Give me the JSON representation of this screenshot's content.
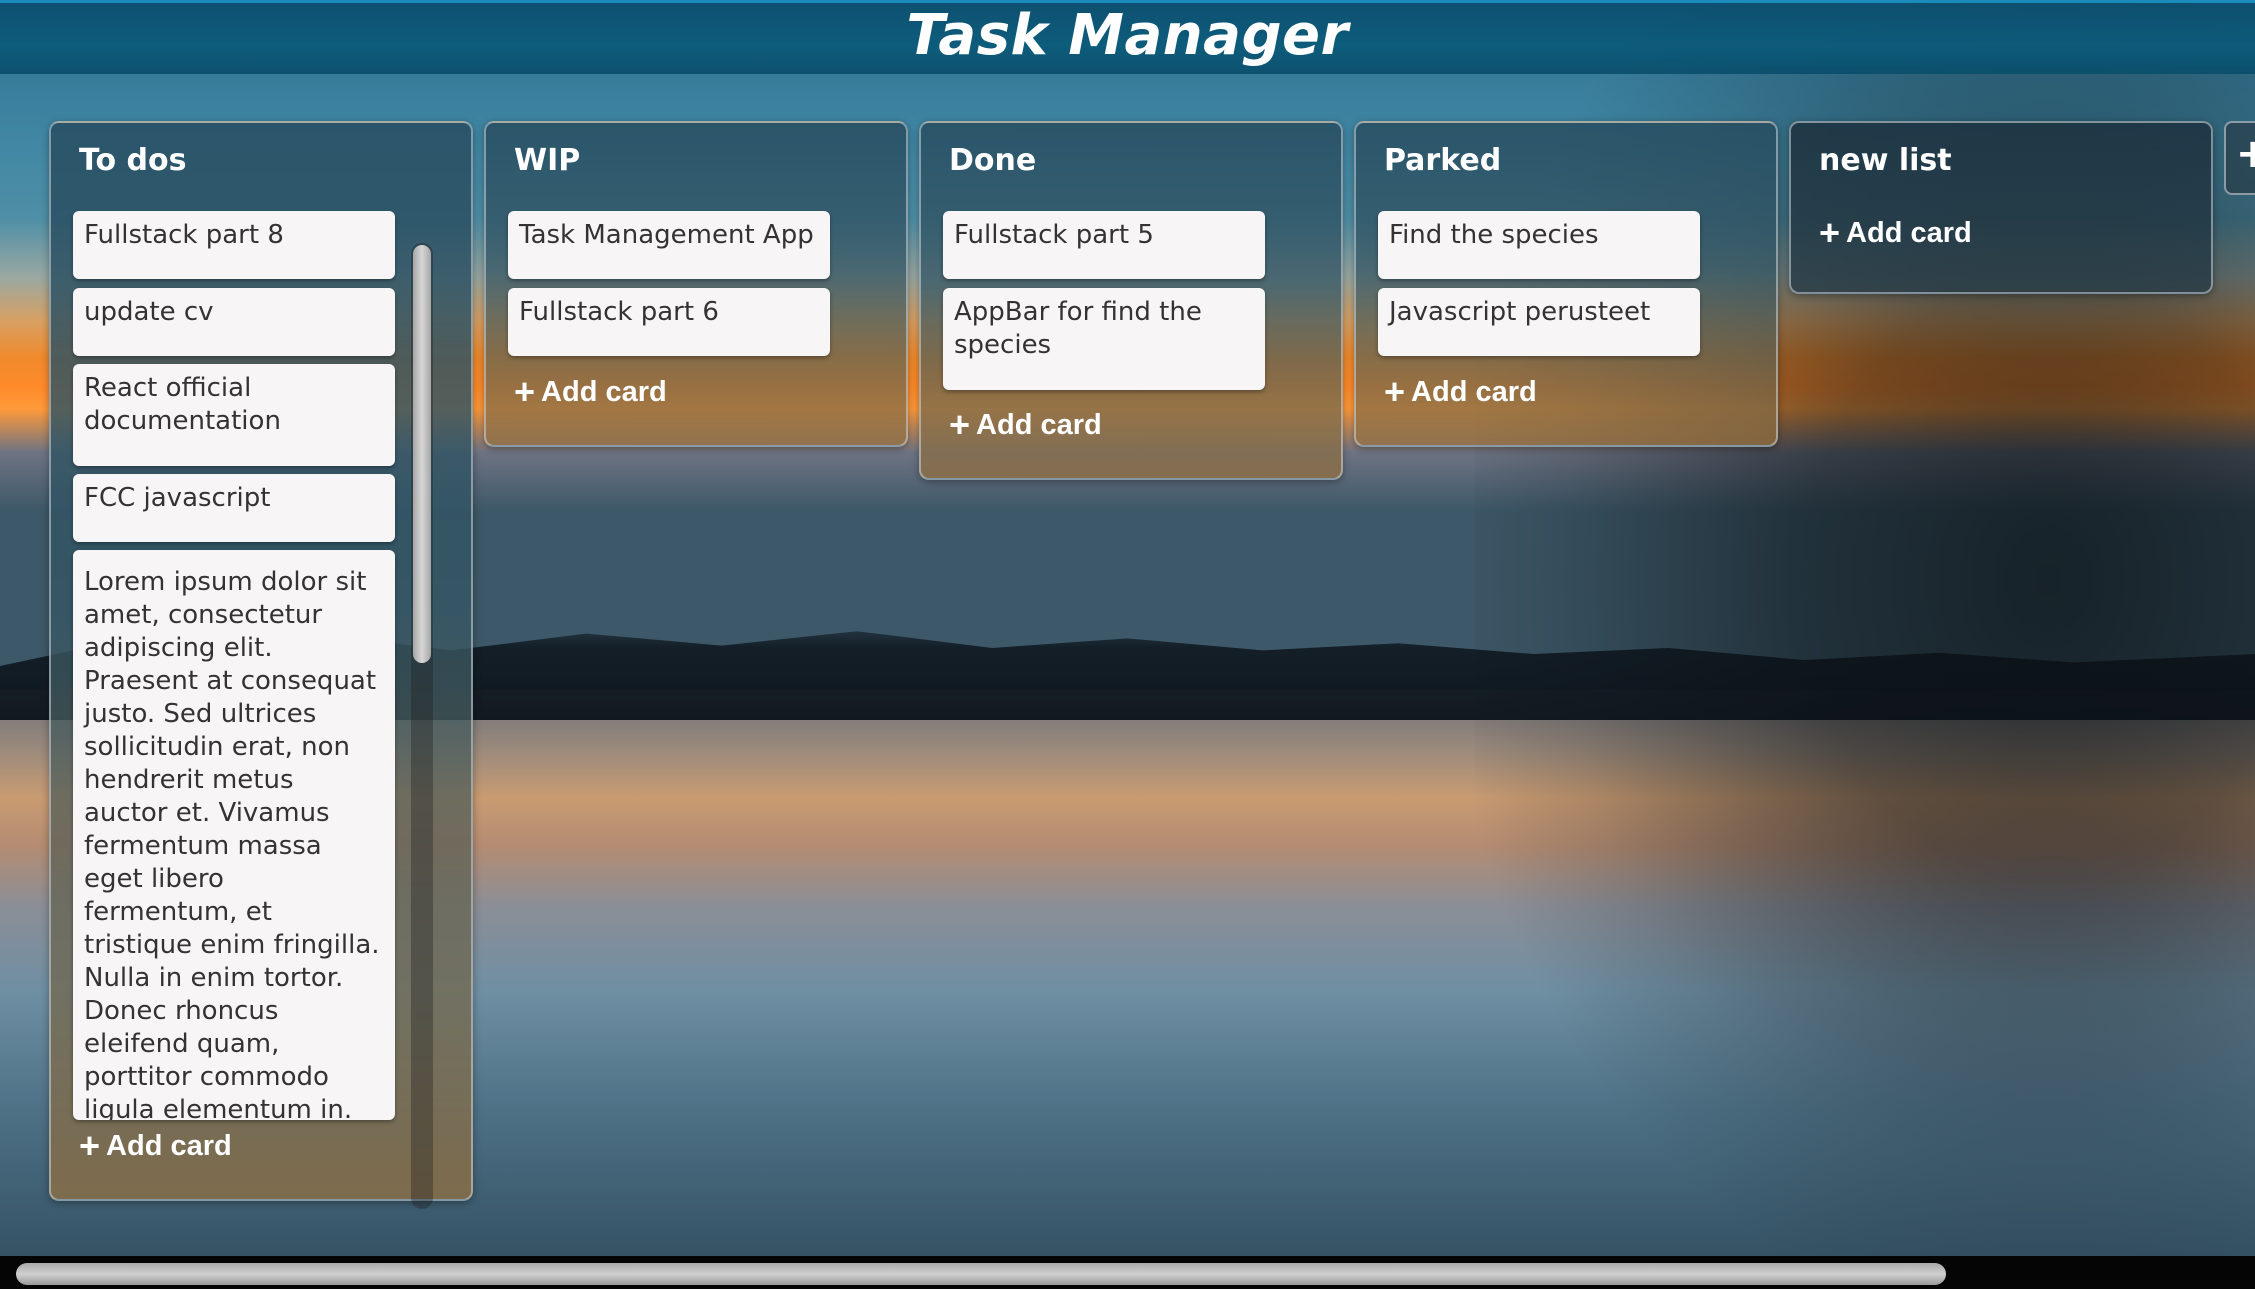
{
  "app": {
    "title": "Task Manager"
  },
  "lists": [
    {
      "title": "To dos",
      "cards": [
        "Fullstack part 8",
        "update cv",
        "React official documentation",
        "FCC javascript",
        "Lorem ipsum dolor sit amet, consectetur adipiscing elit. Praesent at consequat justo. Sed ultrices sollicitudin erat, non hendrerit metus auctor et. Vivamus fermentum massa eget libero fermentum, et tristique enim fringilla. Nulla in enim tortor. Donec rhoncus eleifend quam, porttitor commodo ligula elementum in. Quisque sodales nec"
      ],
      "add_label": "Add card"
    },
    {
      "title": "WIP",
      "cards": [
        "Task Management App",
        "Fullstack part 6"
      ],
      "add_label": "Add card"
    },
    {
      "title": "Done",
      "cards": [
        "Fullstack part 5",
        "AppBar for find the species"
      ],
      "add_label": "Add card"
    },
    {
      "title": "Parked",
      "cards": [
        "Find the species",
        "Javascript perusteet"
      ],
      "add_label": "Add card"
    },
    {
      "title": "new list",
      "cards": [],
      "add_label": "Add card"
    }
  ],
  "add_list": {
    "icon": "plus-icon"
  },
  "icons": {
    "add_card": "plus-icon"
  }
}
